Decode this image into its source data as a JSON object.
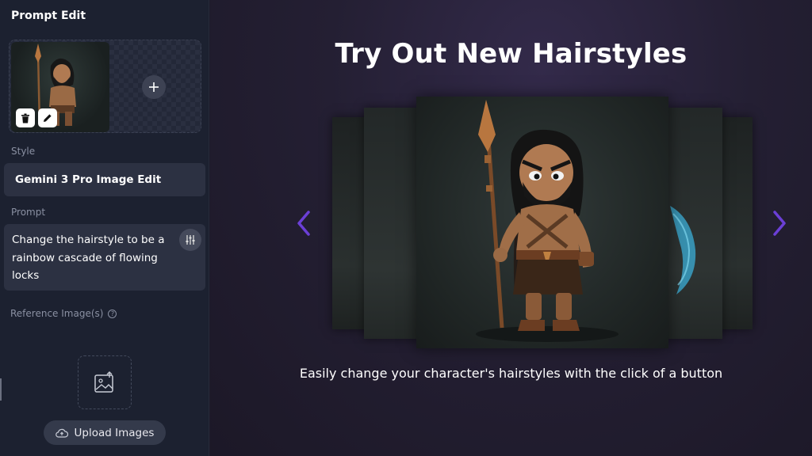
{
  "sidebar": {
    "title": "Prompt Edit",
    "thumbnail": {
      "delete_icon": "trash-icon",
      "edit_icon": "pencil-icon",
      "add_icon": "plus-icon"
    },
    "style_label": "Style",
    "style_value": "Gemini 3 Pro Image Edit",
    "prompt_label": "Prompt",
    "prompt_value": "Change the hairstyle to be a rainbow cascade of flowing locks",
    "prompt_settings_icon": "sliders-icon",
    "reference_label": "Reference Image(s)",
    "reference_help_icon": "question-circle-icon",
    "upload_icon": "image-upload-icon",
    "upload_button_label": "Upload Images",
    "upload_button_icon": "cloud-upload-icon"
  },
  "main": {
    "title": "Try Out New Hairstyles",
    "caption": "Easily change your character's hairstyles with the click of a button",
    "prev_icon": "chevron-left-icon",
    "next_icon": "chevron-right-icon",
    "accent_color": "#6b3fd6"
  },
  "colors": {
    "sidebar_bg": "#1c2130",
    "field_bg": "#2c3142",
    "main_bg": "#241f33",
    "arrow": "#6b3fd6"
  }
}
